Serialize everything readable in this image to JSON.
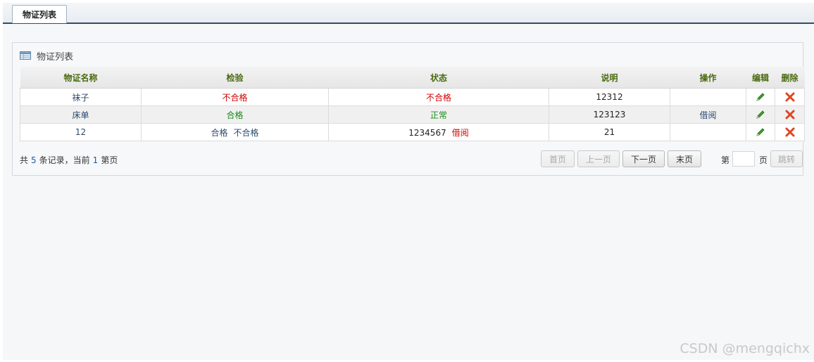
{
  "tab": {
    "label": "物证列表"
  },
  "panel": {
    "title": "物证列表",
    "icon": "table-icon"
  },
  "table": {
    "headers": [
      "物证名称",
      "检验",
      "状态",
      "说明",
      "操作",
      "编辑",
      "删除"
    ],
    "rows": [
      {
        "name": "袜子",
        "inspection": [
          "不合格"
        ],
        "status": "不合格",
        "status_link": "",
        "note": "12312",
        "action": ""
      },
      {
        "name": "床单",
        "inspection": [
          "合格"
        ],
        "status": "正常",
        "status_link": "",
        "note": "123123",
        "action": "借阅"
      },
      {
        "name": "12",
        "inspection": [
          "合格",
          "不合格"
        ],
        "status": "1234567",
        "status_link": "借阅",
        "note": "21",
        "action": ""
      }
    ],
    "edit_icon": "pencil-icon",
    "delete_icon": "delete-x-icon"
  },
  "pager": {
    "prefix": "共",
    "total": "5",
    "middle": "条记录，当前",
    "current": "1",
    "suffix": "第页",
    "first": "首页",
    "prev": "上一页",
    "next": "下一页",
    "last": "末页",
    "goto_prefix": "第",
    "goto_value": "",
    "goto_suffix": "页",
    "jump": "跳转"
  },
  "watermark": "CSDN @mengqichx",
  "colors": {
    "header_text": "#4a6b11",
    "fail": "#d40000",
    "pass": "#1a8a1a",
    "link": "#2b4a6e",
    "nav_line": "#2f4d68"
  }
}
